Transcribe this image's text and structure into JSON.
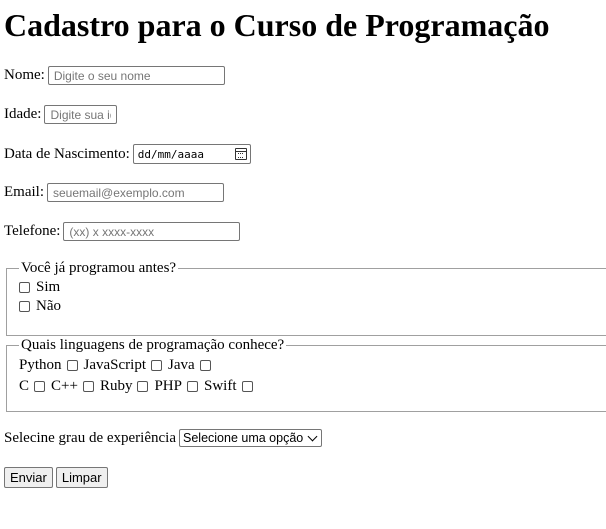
{
  "page": {
    "title": "Cadastro para o Curso de Programação"
  },
  "form": {
    "nome": {
      "label": "Nome:",
      "placeholder": "Digite o seu nome"
    },
    "idade": {
      "label": "Idade:",
      "placeholder": "Digite sua idade"
    },
    "nascimento": {
      "label": "Data de Nascimento:",
      "placeholder": "dd/mm/aaaa",
      "icon": "calendar-icon"
    },
    "email": {
      "label": "Email:",
      "placeholder": "seuemail@exemplo.com"
    },
    "telefone": {
      "label": "Telefone:",
      "placeholder": "(xx) x xxxx-xxxx"
    },
    "programou": {
      "legend": "Você já programou antes?",
      "options": [
        "Sim",
        "Não"
      ]
    },
    "linguagens": {
      "legend": "Quais linguagens de programação conhece?",
      "options": [
        "Python",
        "JavaScript",
        "Java",
        "C",
        "C++",
        "Ruby",
        "PHP",
        "Swift"
      ]
    },
    "experiencia": {
      "label": "Selecine grau de experiência",
      "selected": "Selecione uma opção"
    },
    "buttons": {
      "submit": "Enviar",
      "reset": "Limpar"
    }
  }
}
